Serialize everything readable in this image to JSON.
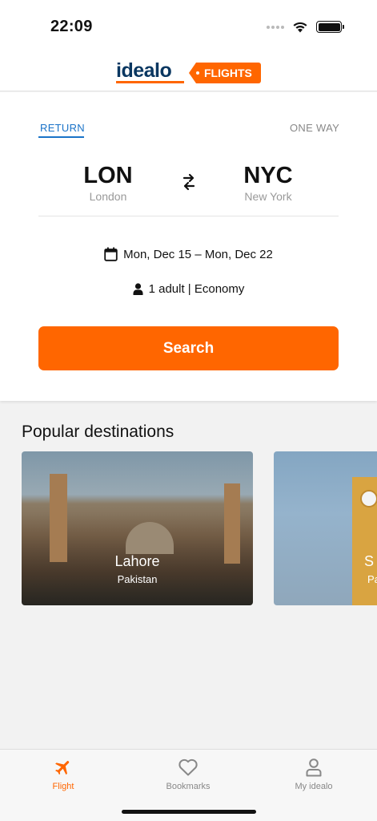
{
  "status_bar": {
    "time": "22:09"
  },
  "header": {
    "logo_text": "idealo",
    "tag_text": "FLIGHTS"
  },
  "trip_tabs": {
    "return_label": "RETURN",
    "one_way_label": "ONE WAY",
    "selected": "RETURN"
  },
  "route": {
    "origin": {
      "code": "LON",
      "city": "London"
    },
    "destination": {
      "code": "NYC",
      "city": "New York"
    }
  },
  "dates": {
    "text": "Mon, Dec 15 – Mon, Dec 22",
    "icon": "calendar-icon"
  },
  "passengers": {
    "text": "1 adult | Economy",
    "icon": "person-icon"
  },
  "search_button": {
    "label": "Search"
  },
  "popular": {
    "title": "Popular destinations",
    "cards": [
      {
        "name": "Lahore",
        "country": "Pakistan"
      },
      {
        "name": "S",
        "country": "Pa"
      }
    ]
  },
  "tab_bar": {
    "items": [
      {
        "label": "Flight",
        "icon": "plane-icon",
        "active": true
      },
      {
        "label": "Bookmarks",
        "icon": "heart-icon",
        "active": false
      },
      {
        "label": "My idealo",
        "icon": "user-icon",
        "active": false
      }
    ]
  },
  "colors": {
    "accent": "#ff6600",
    "link_blue": "#1a73c8",
    "brand_navy": "#0a3761"
  }
}
